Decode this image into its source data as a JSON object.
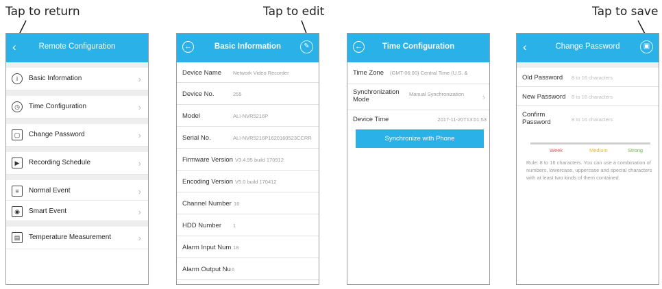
{
  "callouts": {
    "return": "Tap to return",
    "edit": "Tap to edit",
    "save": "Tap to save"
  },
  "screen1": {
    "title": "Remote Configuration",
    "items": [
      {
        "label": "Basic Information",
        "icon": "info-icon"
      },
      {
        "label": "Time Configuration",
        "icon": "clock-icon"
      },
      {
        "label": "Change Password",
        "icon": "lock-icon"
      },
      {
        "label": "Recording Schedule",
        "icon": "recording-icon"
      },
      {
        "label": "Normal Event",
        "icon": "list-icon"
      },
      {
        "label": "Smart Event",
        "icon": "smart-event-icon"
      },
      {
        "label": "Temperature Measurement",
        "icon": "temperature-icon"
      }
    ]
  },
  "screen2": {
    "title": "Basic Information",
    "rows": [
      {
        "key": "Device Name",
        "value": "Network Video Recorder"
      },
      {
        "key": "Device No.",
        "value": "255"
      },
      {
        "key": "Model",
        "value": "ALI-NVR5216P"
      },
      {
        "key": "Serial No.",
        "value": "ALI-NVR5216P1620160523CCRR"
      },
      {
        "key": "Firmware Version",
        "value": "V3.4.95 build 170912"
      },
      {
        "key": "Encoding Version",
        "value": "V5.0 build 170412"
      },
      {
        "key": "Channel Number",
        "value": "16"
      },
      {
        "key": "HDD Number",
        "value": "1"
      },
      {
        "key": "Alarm Input Num",
        "value": "18"
      },
      {
        "key": "Alarm Output Nu",
        "value": "6"
      }
    ]
  },
  "screen3": {
    "title": "Time Configuration",
    "time_zone_label": "Time Zone",
    "time_zone_value": "(GMT-06:00) Central Time (U.S. &",
    "sync_mode_label": "Synchronization Mode",
    "sync_mode_value": "Manual Synchronization",
    "device_time_label": "Device Time",
    "device_time_value": "2017-11-20T13:01:53",
    "sync_button": "Synchronize with Phone"
  },
  "screen4": {
    "title": "Change Password",
    "old_label": "Old Password",
    "old_placeholder": "8 to 16 characters",
    "new_label": "New Password",
    "new_placeholder": "8 to 16 characters",
    "confirm_label": "Confirm Password",
    "confirm_placeholder": "8 to 16 characters",
    "strength": {
      "weak": "Week",
      "medium": "Medium",
      "strong": "Strong"
    },
    "rule": "Rule: 8 to 16 characters. You can use a combination of numbers, lowercase, uppercase and special characters with at least two kinds of them contained."
  },
  "colors": {
    "header": "#29b1e8",
    "weak": "#e05555",
    "medium": "#f5b820",
    "strong": "#6bb84a"
  }
}
